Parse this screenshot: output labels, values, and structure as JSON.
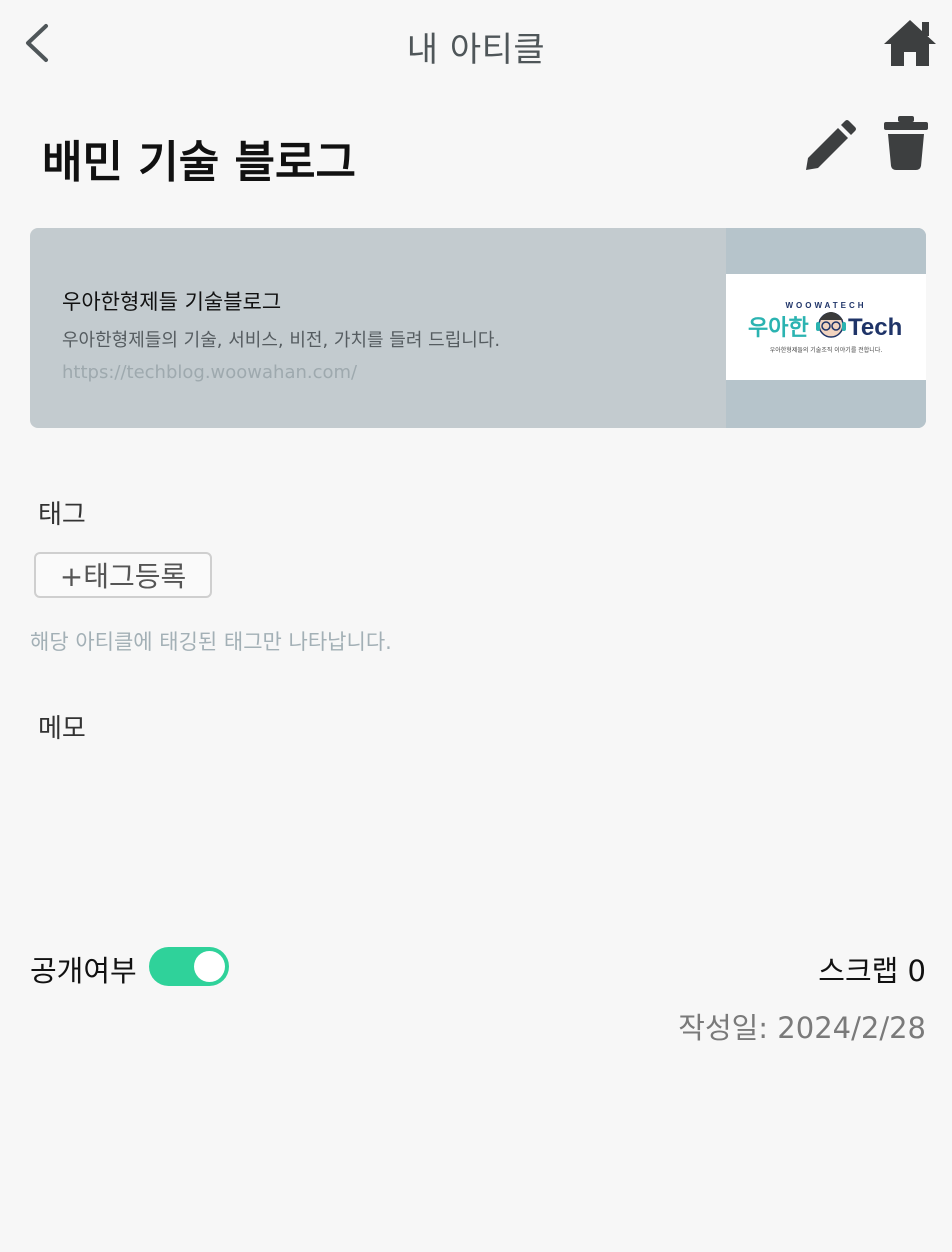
{
  "header": {
    "title": "내 아티클"
  },
  "article": {
    "title": "배민 기술 블로그"
  },
  "preview": {
    "site_name": "우아한형제들 기술블로그",
    "description": "우아한형제들의 기술, 서비스, 비전, 가치를 들려 드립니다.",
    "url": "https://techblog.woowahan.com/",
    "thumbnail": {
      "top_text": "WOOWATECH",
      "brand_korean": "우아한",
      "brand_english": "Tech",
      "tagline": "우아한형제들의 기술조직 이야기를 전합니다."
    }
  },
  "tags": {
    "label": "태그",
    "add_button": "+태그등록",
    "hint": "해당 아티클에 태깅된 태그만 나타납니다."
  },
  "memo": {
    "label": "메모",
    "value": ""
  },
  "footer": {
    "public_label": "공개여부",
    "public_enabled": true,
    "scrap": "스크랩 0",
    "created": "작성일: 2024/2/28"
  },
  "colors": {
    "background": "#f7f7f7",
    "toggle_on": "#2fd29a",
    "card_bg": "#c3cbcf",
    "brand_teal": "#2bb3b1",
    "brand_navy": "#1f3468"
  }
}
